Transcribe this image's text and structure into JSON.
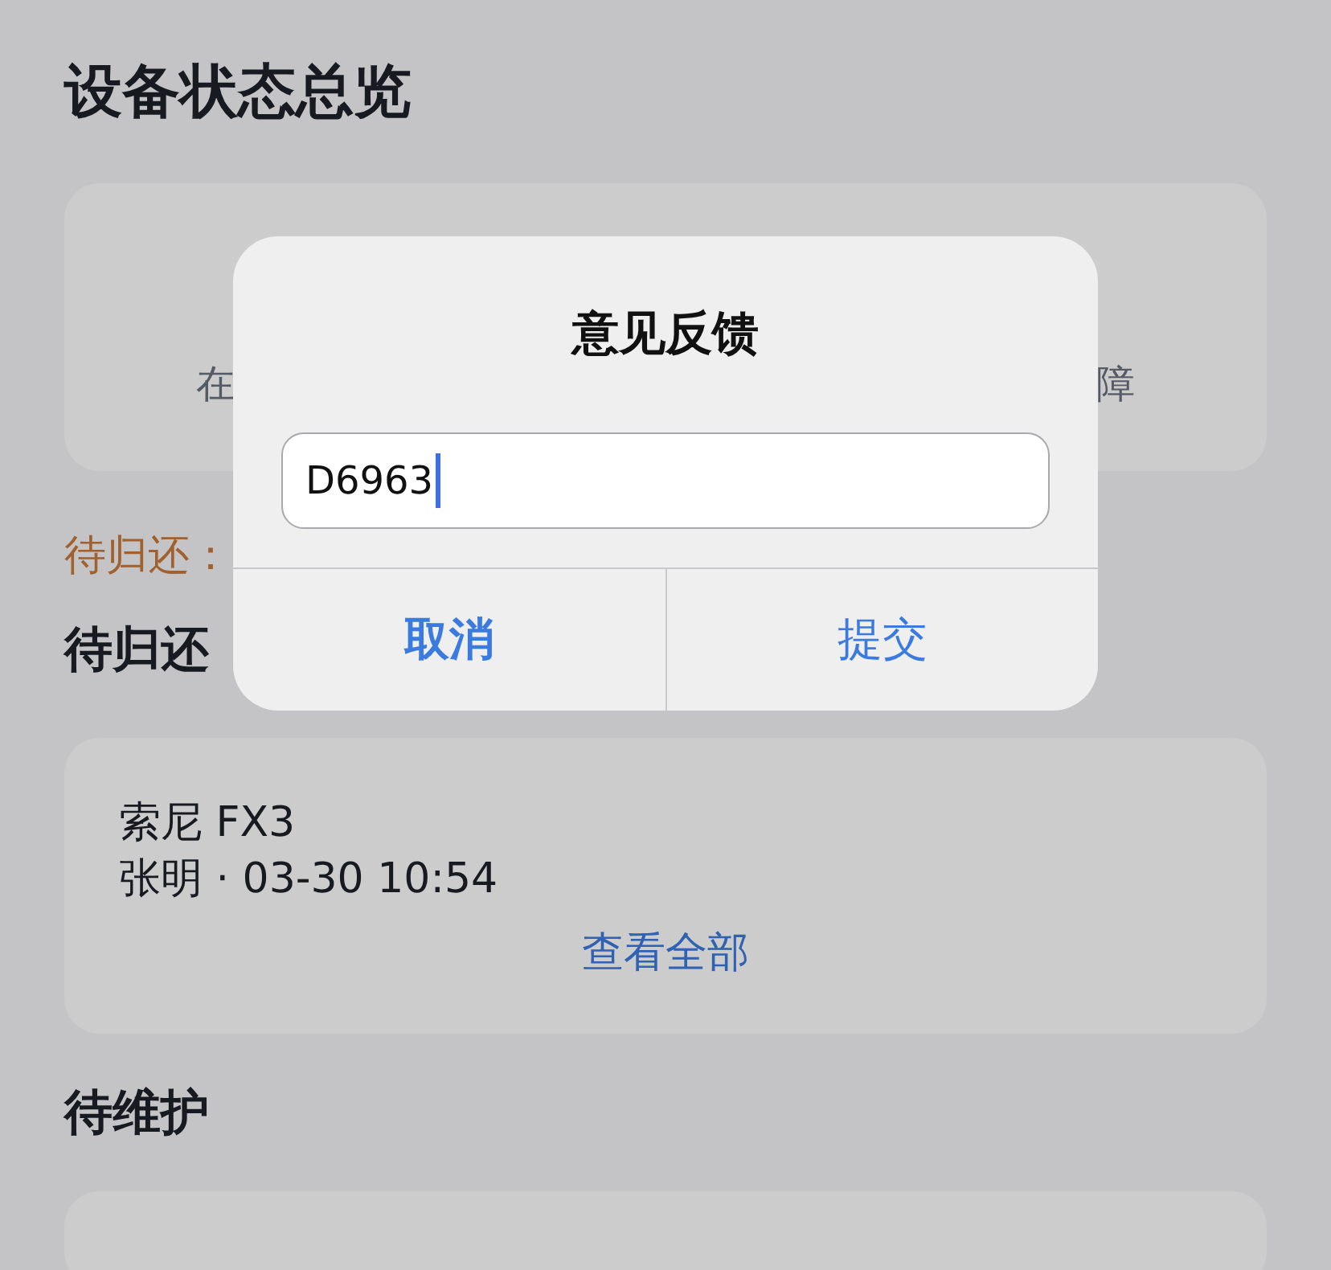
{
  "page": {
    "title": "设备状态总览",
    "stats": [
      {
        "label": "在"
      },
      {
        "label": "障"
      }
    ],
    "pending_notice": "待归还：",
    "sections": [
      {
        "heading": "待归还",
        "card": {
          "items": [
            {
              "name": "索尼 FX3",
              "detail": "张明 · 03-30 10:54"
            }
          ],
          "link": "查看全部"
        }
      },
      {
        "heading": "待维护"
      }
    ]
  },
  "dialog": {
    "title": "意见反馈",
    "input": {
      "value": "D6963",
      "focused": true
    },
    "buttons": [
      {
        "label": "取消",
        "kind": "cancel"
      },
      {
        "label": "提交",
        "kind": "confirm"
      }
    ]
  }
}
